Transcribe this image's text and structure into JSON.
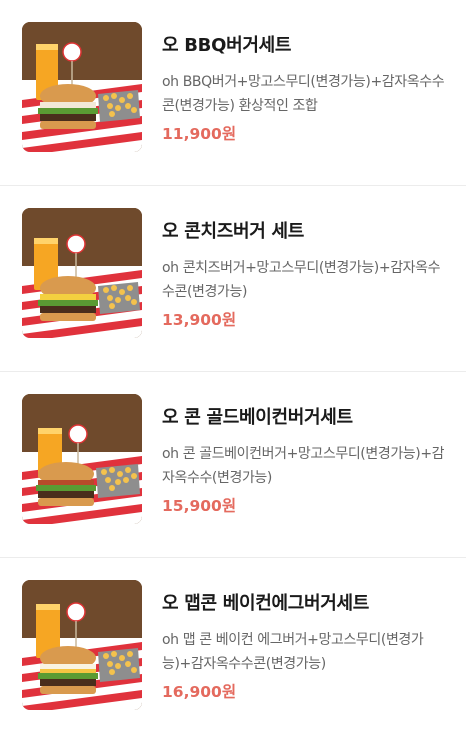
{
  "menu": {
    "items": [
      {
        "name": "오 BBQ버거세트",
        "description": "oh BBQ버거+망고스무디(변경가능)+감자옥수수콘(변경가능) 환상적인 조합",
        "price": "11,900원"
      },
      {
        "name": "오 콘치즈버거 세트",
        "description": "oh 콘치즈버거+망고스무디(변경가능)+감자옥수수콘(변경가능)",
        "price": "13,900원"
      },
      {
        "name": "오 콘 골드베이컨버거세트",
        "description": "oh 콘 골드베이컨버거+망고스무디(변경가능)+감자옥수수(변경가능)",
        "price": "15,900원"
      },
      {
        "name": "오 맵콘 베이컨에그버거세트",
        "description": "oh 맵 콘 베이컨 에그버거+망고스무디(변경가능)+감자옥수수콘(변경가능)",
        "price": "16,900원"
      }
    ]
  },
  "colors": {
    "price": "#e46a5e",
    "name": "#1a1a1a",
    "description": "#666666"
  },
  "icons": {
    "thumbnail": "burger-set-photo"
  }
}
